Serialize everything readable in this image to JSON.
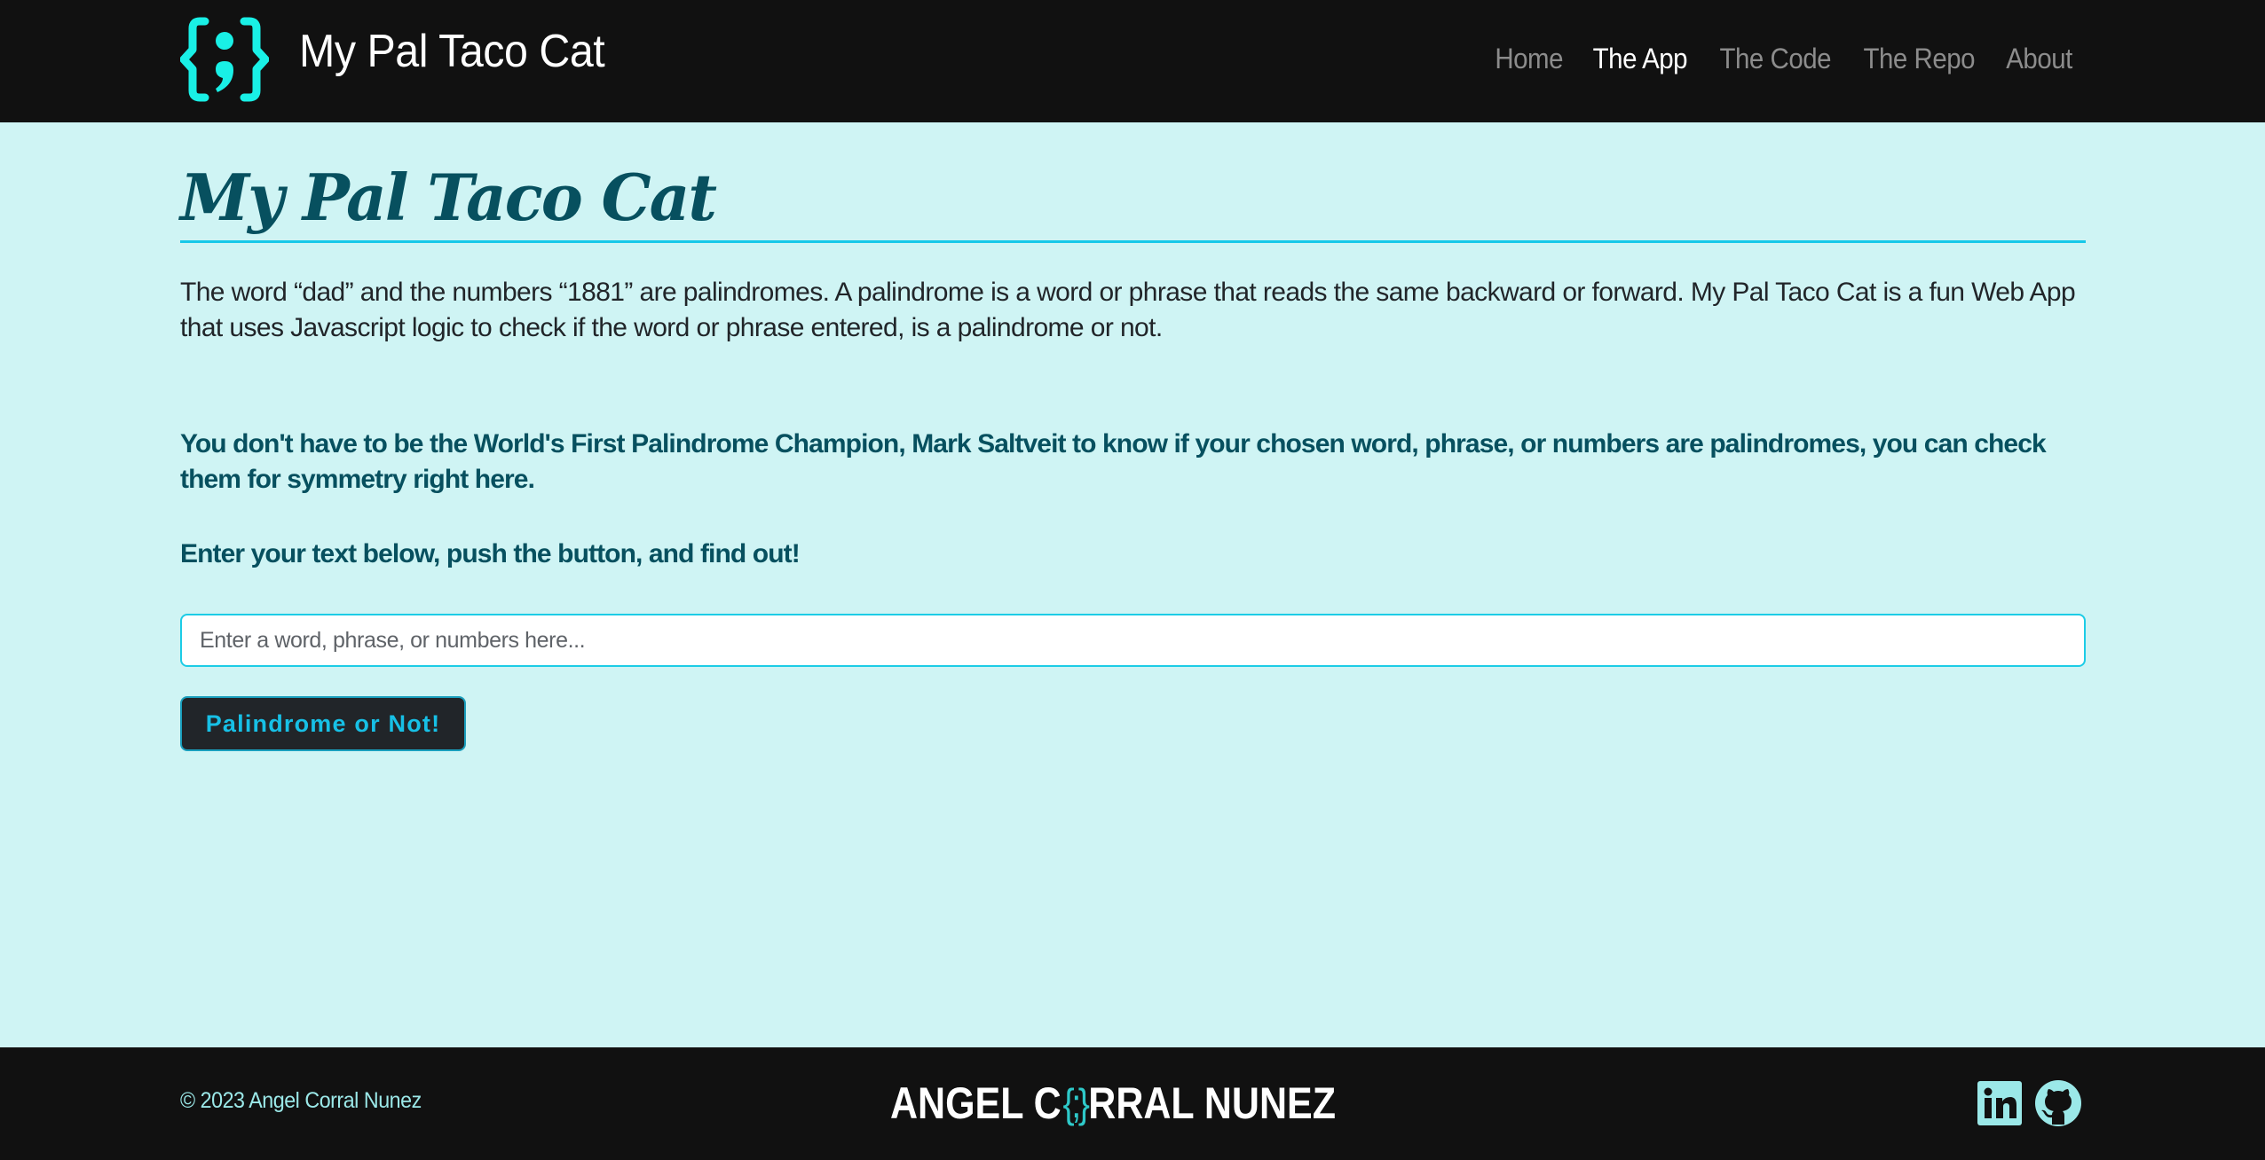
{
  "header": {
    "logo_icon": "curly-braces-semicolon-icon",
    "brand_title": "My Pal Taco Cat",
    "nav": [
      {
        "label": "Home",
        "active": false
      },
      {
        "label": "The App",
        "active": true
      },
      {
        "label": "The Code",
        "active": false
      },
      {
        "label": "The Repo",
        "active": false
      },
      {
        "label": "About",
        "active": false
      }
    ]
  },
  "main": {
    "title": "My Pal Taco Cat",
    "intro": "The word “dad” and the numbers “1881” are palindromes. A palindrome is a word or phrase that reads the same backward or forward. My Pal Taco Cat is a fun Web App that uses Javascript logic to check if the word or phrase entered, is a palindrome or not.",
    "lead_1": "You don't have to be the World's First Palindrome Champion, Mark Saltveit to know if your chosen word, phrase, or numbers are palindromes, you can check them for symmetry right here.",
    "lead_2": "Enter your text below, push the button, and find out!",
    "input": {
      "value": "",
      "placeholder": "Enter a word, phrase, or numbers here..."
    },
    "button_label": "Palindrome or Not!"
  },
  "footer": {
    "copyright": "© 2023 Angel Corral Nunez",
    "brand_left": "ANGEL C",
    "brand_mark": "{;}",
    "brand_right": "RRAL NUNEZ",
    "social": [
      {
        "name": "linkedin-icon"
      },
      {
        "name": "github-icon"
      }
    ]
  },
  "colors": {
    "header_bg": "#111111",
    "page_bg": "#cff4f4",
    "accent_cyan": "#17c8e8",
    "logo_cyan": "#19f0e6",
    "heading_teal": "#07505f",
    "button_bg": "#212529",
    "footer_text": "#9be8e8"
  }
}
